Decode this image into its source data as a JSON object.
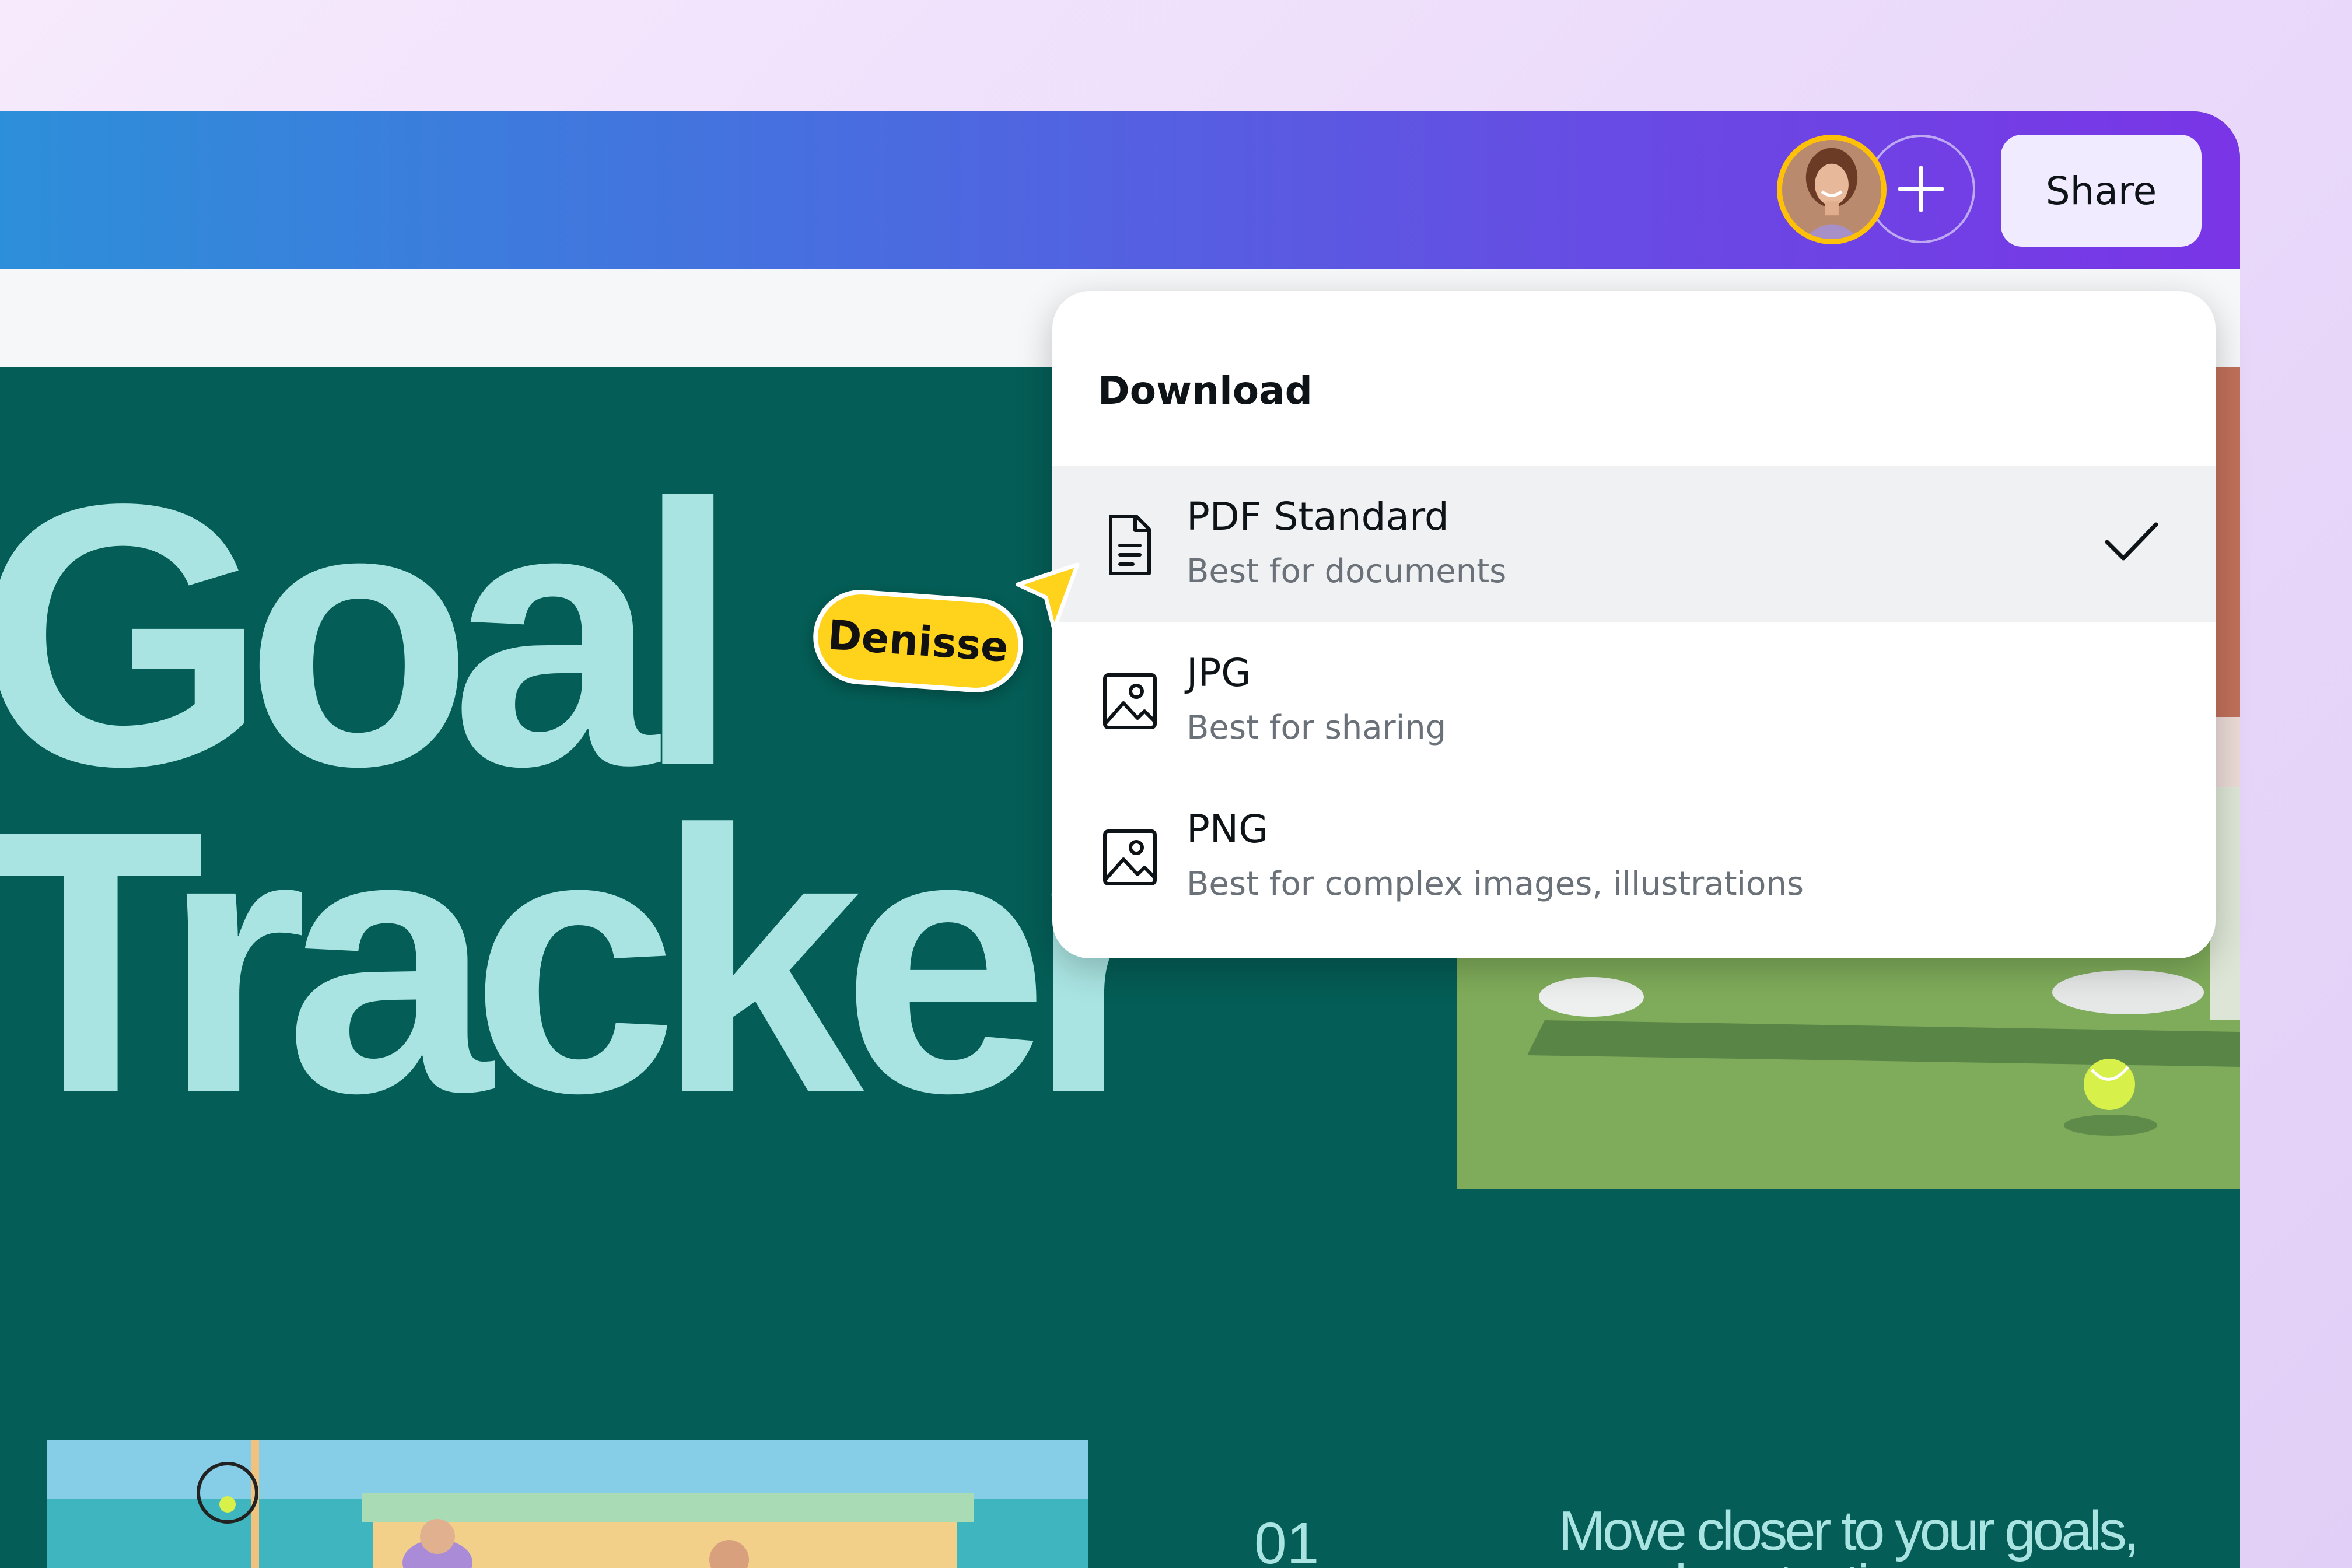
{
  "topbar": {
    "add_label": "+",
    "share_label": "Share"
  },
  "design": {
    "headline_line1": "Goal",
    "headline_line2": "Tracker",
    "page_number": "01",
    "tagline": "Move closer to your goals, one day at a time."
  },
  "download_menu": {
    "title": "Download",
    "options": [
      {
        "label": "PDF Standard",
        "description": "Best for documents",
        "icon": "document-icon",
        "selected": true
      },
      {
        "label": "JPG",
        "description": "Best for sharing",
        "icon": "image-icon",
        "selected": false
      },
      {
        "label": "PNG",
        "description": "Best for complex images, illustrations",
        "icon": "image-icon",
        "selected": false
      }
    ]
  },
  "collaborator": {
    "name": "Denisse"
  },
  "colors": {
    "accent_yellow": "#ffd21c",
    "canvas_green": "#045d56",
    "headline_mint": "#a9e4e2",
    "topbar_start": "#2d8fd9",
    "topbar_end": "#7a35e6"
  }
}
